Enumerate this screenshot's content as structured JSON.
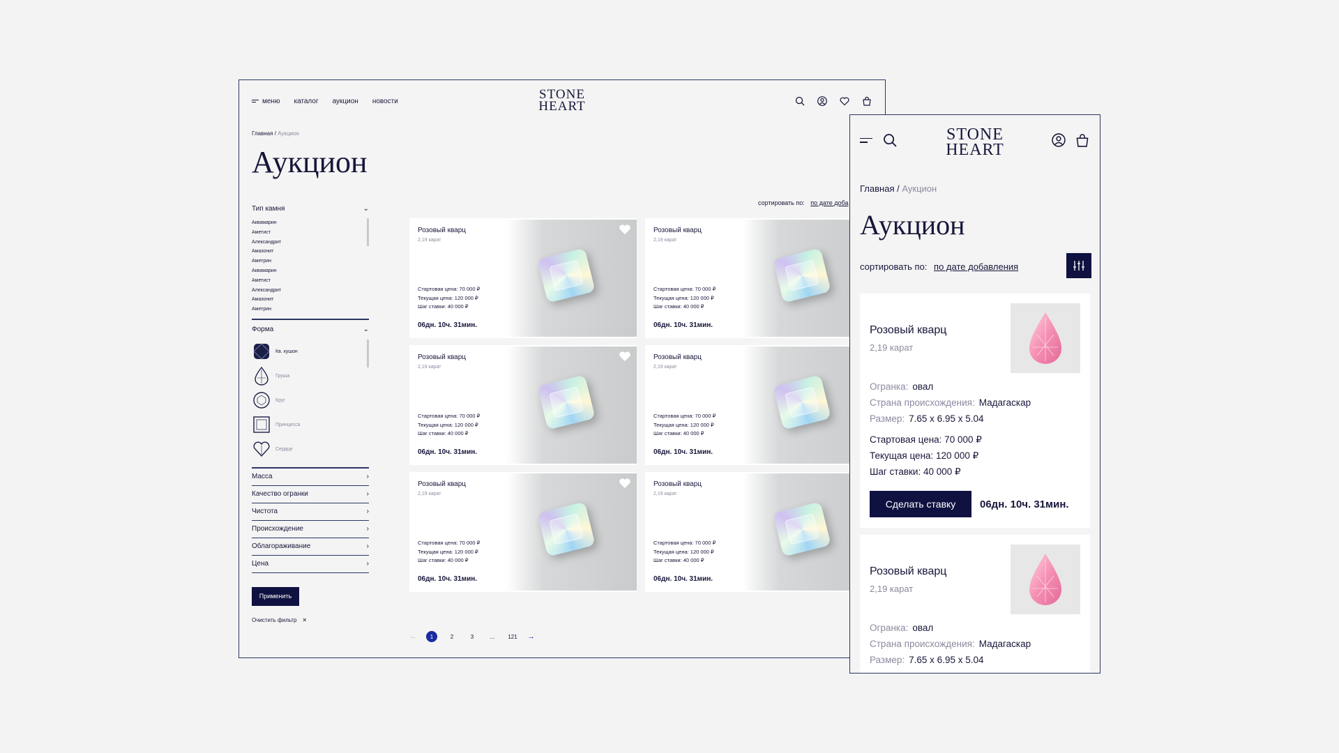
{
  "brand": {
    "line1": "STONE",
    "line2": "HEART"
  },
  "nav": {
    "menu": "меню",
    "catalog": "каталог",
    "auction": "аукцион",
    "news": "новости"
  },
  "icons": [
    "search-icon",
    "account-icon",
    "heart-icon",
    "bag-icon"
  ],
  "breadcrumb": {
    "home": "Главная",
    "sep": "/",
    "current": "Аукцион"
  },
  "page_title": "Аукцион",
  "filters": {
    "stone_type": {
      "label": "Тип камня",
      "options": [
        "Аквамарин",
        "Аметист",
        "Александрит",
        "Амазонит",
        "Аметрин",
        "Аквамарин",
        "Аметист",
        "Александрит",
        "Амазонит",
        "Аметрин"
      ]
    },
    "shape": {
      "label": "Форма",
      "options": [
        {
          "label": "Кв. кушон",
          "icon": "cushion-shape-icon",
          "selected": true
        },
        {
          "label": "Груша",
          "icon": "pear-shape-icon",
          "selected": false
        },
        {
          "label": "Круг",
          "icon": "round-shape-icon",
          "selected": false
        },
        {
          "label": "Принцесса",
          "icon": "princess-shape-icon",
          "selected": false
        },
        {
          "label": "Сердце",
          "icon": "heart-shape-icon",
          "selected": false
        }
      ]
    },
    "collapsed": [
      "Масса",
      "Качество огранки",
      "Чистота",
      "Происхождение",
      "Облагораживание",
      "Цена"
    ],
    "apply": "Применить",
    "clear": "Очистить фильтр"
  },
  "sort": {
    "label": "сортировать по:",
    "value": "по дате добавления",
    "value_truncated": "по дате доба"
  },
  "product_card": {
    "title": "Розовый кварц",
    "carat": "2,19 карат",
    "start_price": "Стартовая цена: 70 000 ₽",
    "current_price": "Текущая цена: 120 000 ₽",
    "bid_step": "Шаг ставки: 40 000 ₽",
    "duration": "06дн. 10ч. 31мин."
  },
  "pagination": {
    "pages": [
      "1",
      "2",
      "3",
      "...",
      "121"
    ],
    "current": "1"
  },
  "mobile": {
    "specs": [
      {
        "key": "Огранка:",
        "value": "овал"
      },
      {
        "key": "Страна происхождения:",
        "value": "Мадагаскар"
      },
      {
        "key": "Размер:",
        "value": "7.65 x 6.95 x 5.04"
      }
    ],
    "bid_button": "Сделать ставку"
  },
  "colors": {
    "navy": "#0f1140",
    "accent_blue": "#1a2aa0",
    "border": "#2a3562",
    "muted": "#8a8aa0",
    "background": "#f3f3f3"
  }
}
